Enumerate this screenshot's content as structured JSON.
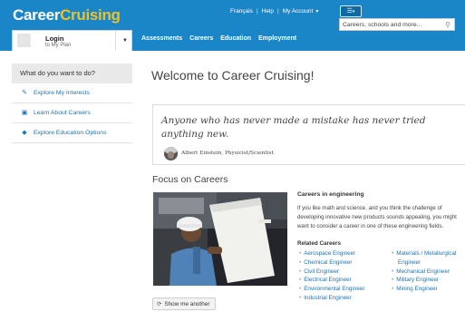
{
  "header": {
    "logo_part1": "Career",
    "logo_part2": "Cruising",
    "links": [
      "Français",
      "Help",
      "My Account"
    ],
    "menu_icon": "list-icon",
    "search_placeholder": "Careers, schools and more..."
  },
  "login": {
    "title": "Login",
    "subtitle": "to My Plan"
  },
  "nav": [
    "Assessments",
    "Careers",
    "Education",
    "Employment"
  ],
  "sidebar": {
    "heading": "What do you want to do?",
    "items": [
      {
        "label": "Explore My Interests",
        "icon": "pencil-icon"
      },
      {
        "label": "Learn About Careers",
        "icon": "briefcase-icon"
      },
      {
        "label": "Explore Education Options",
        "icon": "graduation-cap-icon"
      }
    ]
  },
  "main": {
    "welcome": "Welcome to Career Cruising!",
    "quote": "Anyone who has never made a mistake has never tried anything new.",
    "quote_author": "Albert Einstein, Physicist/Scientist",
    "focus_title": "Focus on Careers",
    "careers_title": "Careers in engineering",
    "careers_desc": [
      "If you like math and science, and you think the challenge of",
      "developing innovative new products sounds appealing, you might",
      "want to consider a career in one of these engineering fields."
    ],
    "related_title": "Related Careers",
    "related_col1": [
      "Aerospace Engineer",
      "Chemical Engineer",
      "Civil Engineer",
      "Electrical Engineer",
      "Environmental Engineer",
      "Industrial Engineer"
    ],
    "related_col2": [
      "Materials / Metallurgical",
      "Engineer",
      "Mechanical Engineer",
      "Military Engineer",
      "Mining Engineer"
    ],
    "show_another": "Show me another"
  },
  "colors": {
    "header_blue": "#1b86c7",
    "logo_yellow": "#f4c11c",
    "link_blue": "#1a74b8"
  }
}
